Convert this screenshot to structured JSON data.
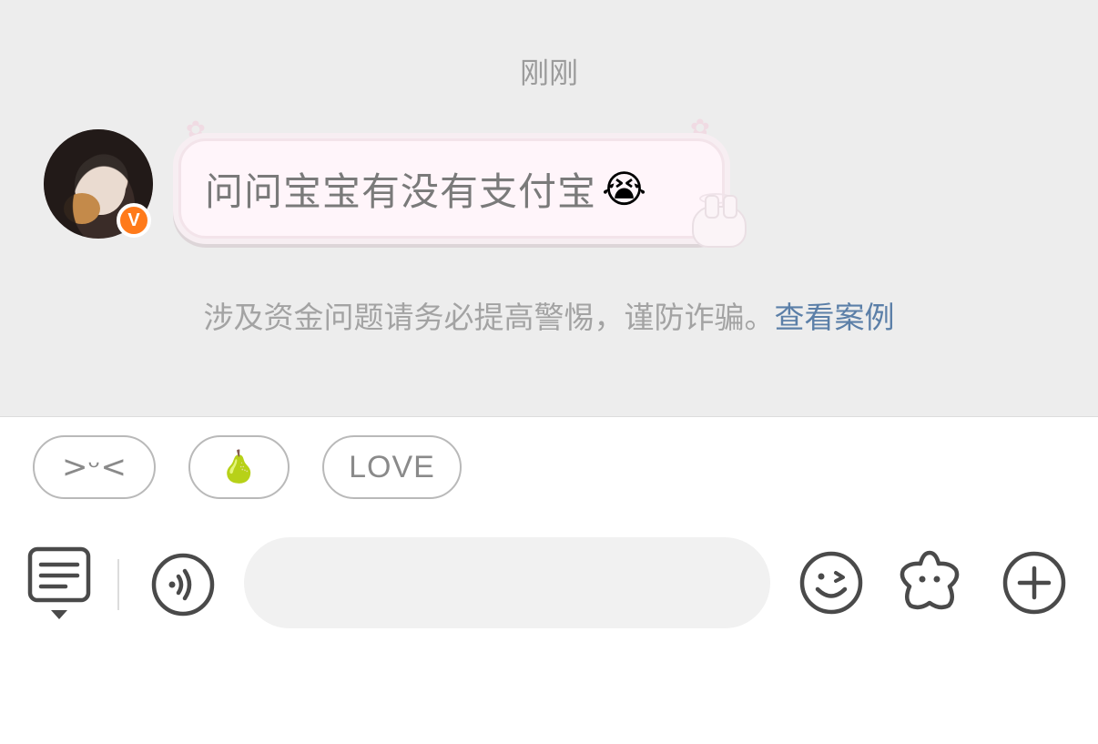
{
  "chat": {
    "timestamp": "刚刚",
    "message": {
      "text": "问问宝宝有没有支付宝",
      "emoji": "😭"
    },
    "verified_badge": "V",
    "warning": {
      "text": "涉及资金问题请务必提高警惕，谨防诈骗。",
      "link": "查看案例",
      "link_color": "#5b7fa8"
    }
  },
  "quick_replies": [
    {
      "label": ">ᵕ<"
    },
    {
      "label": "🍐"
    },
    {
      "label": "LOVE"
    }
  ],
  "toolbar": {
    "input_value": "",
    "input_placeholder": "",
    "icons": [
      "keyboard-switch-icon",
      "voice-icon",
      "emoji-icon",
      "sticker-icon",
      "plus-icon"
    ]
  },
  "colors": {
    "chat_background": "#ededed",
    "badge": "#ff7a1a",
    "bubble_background": "#fff5fa"
  }
}
